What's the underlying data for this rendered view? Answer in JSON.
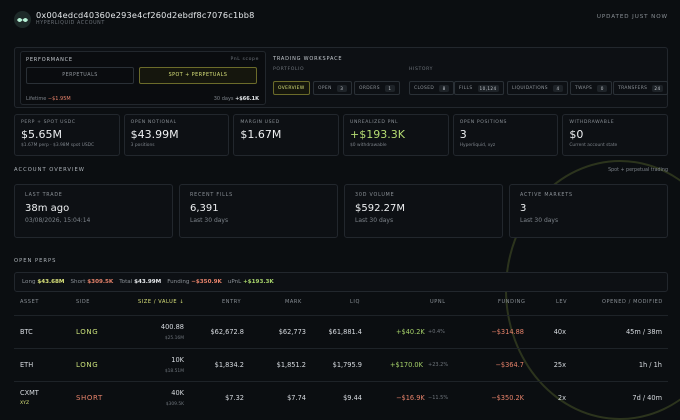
{
  "header": {
    "address": "0x004edcd40360e293e4cf260d2ebdf8c7076c1bb8",
    "account_label": "HYPERLIQUID ACCOUNT",
    "updated": "UPDATED JUST NOW"
  },
  "performance": {
    "title": "PERFORMANCE",
    "scope_label": "PnL scope",
    "buttons": [
      "PERPETUALS",
      "SPOT + PERPETUALS"
    ],
    "active_button": "SPOT + PERPETUALS",
    "lifetime_label": "Lifetime",
    "lifetime_value": "−$1.95M",
    "days_label": "30 days",
    "days_value": "+$66.1K"
  },
  "workspace": {
    "title": "TRADING WORKSPACE",
    "portfolio_label": "PORTFOLIO",
    "history_label": "HISTORY",
    "portfolio_tabs": [
      {
        "label": "OVERVIEW",
        "count": ""
      },
      {
        "label": "OPEN",
        "count": "3"
      },
      {
        "label": "ORDERS",
        "count": "1"
      }
    ],
    "history_tabs": [
      {
        "label": "CLOSED",
        "count": "8"
      },
      {
        "label": "FILLS",
        "count": "10,124"
      },
      {
        "label": "LIQUIDATIONS",
        "count": "4"
      },
      {
        "label": "TWAPS",
        "count": "0"
      },
      {
        "label": "TRANSFERS",
        "count": "24"
      }
    ]
  },
  "stats": [
    {
      "label": "PERP + SPOT USDC",
      "value": "$5.65M",
      "sub": "$1.67M perp · $3.98M spot USDC",
      "color": "#eef0f2"
    },
    {
      "label": "OPEN NOTIONAL",
      "value": "$43.99M",
      "sub": "3 positions",
      "color": "#eef0f2"
    },
    {
      "label": "MARGIN USED",
      "value": "$1.67M",
      "sub": "",
      "color": "#eef0f2"
    },
    {
      "label": "UNREALIZED PNL",
      "value": "+$193.3K",
      "sub": "$0 withdrawable",
      "color": "#b5dc72"
    },
    {
      "label": "OPEN POSITIONS",
      "value": "3",
      "sub": "Hyperliquid, xyz",
      "color": "#eef0f2"
    },
    {
      "label": "WITHDRAWABLE",
      "value": "$0",
      "sub": "Current account state",
      "color": "#eef0f2"
    }
  ],
  "overview": {
    "title": "ACCOUNT OVERVIEW",
    "scope": "Spot + perpetual trading",
    "cards": [
      {
        "label": "LAST TRADE",
        "value": "38m ago",
        "sub": "03/08/2026, 15:04:14"
      },
      {
        "label": "RECENT FILLS",
        "value": "6,391",
        "sub": "Last 30 days"
      },
      {
        "label": "30D VOLUME",
        "value": "$592.27M",
        "sub": "Last 30 days"
      },
      {
        "label": "ACTIVE MARKETS",
        "value": "3",
        "sub": "Last 30 days"
      }
    ]
  },
  "open_perps": {
    "title": "OPEN PERPS",
    "summary": {
      "long_label": "Long",
      "long_value": "$43.68M",
      "short_label": "Short",
      "short_value": "$309.5K",
      "total_label": "Total",
      "total_value": "$43.99M",
      "funding_label": "Funding",
      "funding_value": "−$350.9K",
      "upnl_label": "uPnL",
      "upnl_value": "+$193.3K"
    },
    "columns": [
      "ASSET",
      "SIDE",
      "SIZE / VALUE ↓",
      "ENTRY",
      "MARK",
      "LIQ",
      "UPNL",
      "FUNDING",
      "LEV",
      "OPENED / MODIFIED"
    ],
    "rows": [
      {
        "asset": "BTC",
        "asset_sub": "",
        "side": "LONG",
        "size": "400.88",
        "value": "$25.16M",
        "entry": "$62,672.8",
        "mark": "$62,773",
        "liq": "$61,881.4",
        "upnl": "+$40.2K",
        "upnl_pct": "+0.4%",
        "funding": "−$314.88",
        "lev": "40x",
        "opened": "45m / 38m"
      },
      {
        "asset": "ETH",
        "asset_sub": "",
        "side": "LONG",
        "size": "10K",
        "value": "$18.51M",
        "entry": "$1,834.2",
        "mark": "$1,851.2",
        "liq": "$1,795.9",
        "upnl": "+$170.0K",
        "upnl_pct": "+23.2%",
        "funding": "−$364.7",
        "lev": "25x",
        "opened": "1h / 1h"
      },
      {
        "asset": "CXMT",
        "asset_sub": "XYZ",
        "side": "SHORT",
        "size": "40K",
        "value": "$309.5K",
        "entry": "$7.32",
        "mark": "$7.74",
        "liq": "$9.44",
        "upnl": "−$16.9K",
        "upnl_pct": "−11.5%",
        "funding": "−$350.2K",
        "lev": "2x",
        "opened": "7d / 40m"
      }
    ]
  },
  "colors": {
    "accent": "#d9e27a",
    "positive": "#a6d26a",
    "negative": "#e6826a",
    "background": "#0b0e11"
  }
}
